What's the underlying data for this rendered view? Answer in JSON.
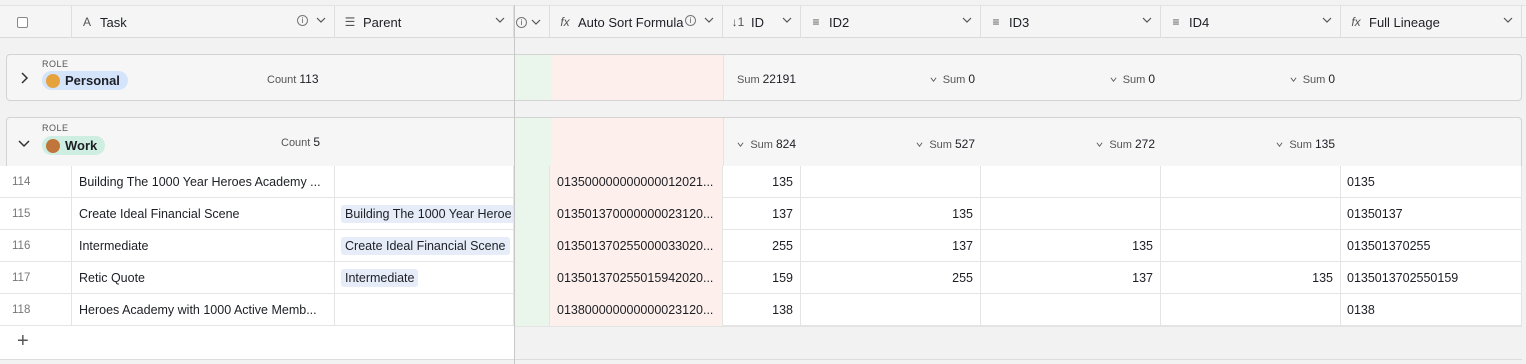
{
  "columns": {
    "task": "Task",
    "parent": "Parent",
    "auto_sort": "Auto Sort Formula",
    "id": "ID",
    "id2": "ID2",
    "id3": "ID3",
    "id4": "ID4",
    "full_lineage": "Full Lineage"
  },
  "icons": {
    "task": "A",
    "parent": "☰",
    "formula": "fx",
    "id": "↓1",
    "lookup": "≡"
  },
  "groups": [
    {
      "role_label": "ROLE",
      "name": "Personal",
      "count_label": "Count",
      "count": "113",
      "sum_label": "Sum",
      "sum_id": "22191",
      "sum_id2": "0",
      "sum_id3": "0",
      "sum_id4": "0",
      "pill_color": "#d4e4fb",
      "emoji_color": "#e6a23c"
    },
    {
      "role_label": "ROLE",
      "name": "Work",
      "count_label": "Count",
      "count": "5",
      "sum_label": "Sum",
      "sum_id": "824",
      "sum_id2": "527",
      "sum_id3": "272",
      "sum_id4": "135",
      "pill_color": "#cdeee0",
      "emoji_color": "#c0763a"
    }
  ],
  "rows": [
    {
      "num": "114",
      "task": "Building The 1000 Year Heroes Academy ...",
      "parent": "",
      "sort": "013500000000000012021...",
      "id": "135",
      "id2": "",
      "id3": "",
      "id4": "",
      "lineage": "0135"
    },
    {
      "num": "115",
      "task": "Create Ideal Financial Scene",
      "parent": "Building The 1000 Year Heroe",
      "sort": "013501370000000023120...",
      "id": "137",
      "id2": "135",
      "id3": "",
      "id4": "",
      "lineage": "01350137"
    },
    {
      "num": "116",
      "task": "Intermediate",
      "parent": "Create Ideal Financial Scene",
      "sort": "013501370255000033020...",
      "id": "255",
      "id2": "137",
      "id3": "135",
      "id4": "",
      "lineage": "013501370255"
    },
    {
      "num": "117",
      "task": "Retic Quote",
      "parent": "Intermediate",
      "sort": "013501370255015942020...",
      "id": "159",
      "id2": "255",
      "id3": "137",
      "id4": "135",
      "lineage": "0135013702550159"
    },
    {
      "num": "118",
      "task": "Heroes Academy with 1000 Active Memb...",
      "parent": "",
      "sort": "013800000000000023120...",
      "id": "138",
      "id2": "",
      "id3": "",
      "id4": "",
      "lineage": "0138"
    }
  ],
  "add_row_symbol": "+",
  "colors": {
    "sort_bg": "#fdf0ec",
    "green_bg": "#eaf6ec",
    "chip_bg": "#e6ecf8"
  }
}
